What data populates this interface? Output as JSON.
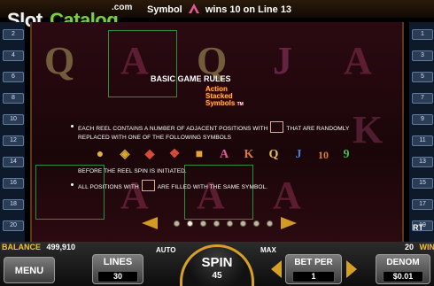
{
  "logo": {
    "slot": "Slot",
    "catalog": "Catalog",
    "com": ".com"
  },
  "header": {
    "message_before": "Symbol",
    "message_after": "wins 10 on Line 13"
  },
  "paytable": {
    "title": "BASIC GAME RULES",
    "brand_line1": "Action",
    "brand_line2": "Stacked",
    "brand_line3": "Symbols",
    "brand_tm": "TM",
    "rule1_part1": "EACH REEL CONTAINS A NUMBER OF ADJACENT POSITIONS WITH",
    "rule1_part2": "THAT ARE RANDOMLY",
    "rule1_part3": "REPLACED WITH ONE OF THE FOLLOWING SYMBOLS",
    "rule2": "BEFORE THE REEL SPIN IS INITIATED.",
    "rule3_part1": "ALL   POSITIONS WITH",
    "rule3_part2": "ARE FILLED WITH THE SAME SYMBOL.",
    "symbols": [
      "A",
      "K",
      "Q",
      "J",
      "10",
      "9"
    ],
    "page_count": 8,
    "active_page": 1
  },
  "reels_bg": [
    "Q",
    "A",
    "Q",
    "J",
    "A",
    "A",
    "K",
    "A",
    "A"
  ],
  "line_markers_left": [
    "2",
    "4",
    "6",
    "8",
    "10",
    "12",
    "14",
    "16",
    "18",
    "20"
  ],
  "line_markers_right": [
    "1",
    "3",
    "5",
    "7",
    "9",
    "11",
    "13",
    "15",
    "17",
    "19"
  ],
  "bottom": {
    "balance_label": "BALANCE",
    "balance_value": "499,910",
    "lines_right": "20",
    "win_label": "WIN",
    "menu_label": "MENU",
    "lines_label": "LINES",
    "lines_value": "30",
    "auto_label": "AUTO",
    "spin_label": "SPIN",
    "spin_value": "45",
    "max_label": "MAX",
    "betper_label": "BET PER",
    "betper_value": "1",
    "denom_label": "DENOM",
    "denom_value": "$0.01",
    "rt_label": "RT"
  },
  "colors": {
    "accent": "#d6a024",
    "line_green": "#2e8f3b",
    "reel_bg": "#2b0a12"
  }
}
